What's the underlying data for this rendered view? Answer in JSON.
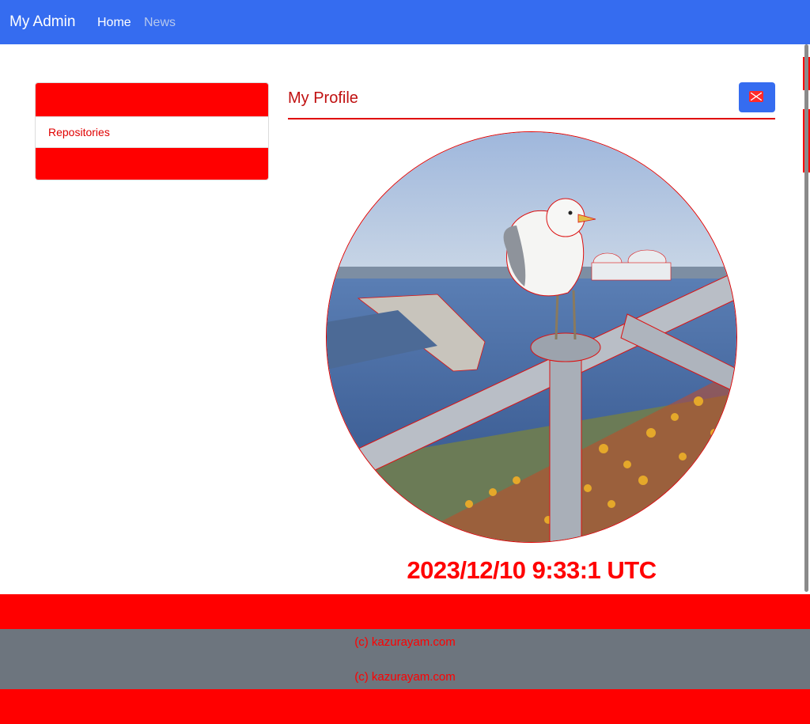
{
  "navbar": {
    "brand": "My Admin",
    "links": [
      {
        "label": "Home",
        "active": true
      },
      {
        "label": "News",
        "active": false
      }
    ],
    "color": "#356cf0"
  },
  "sidebar": {
    "items": [
      {
        "label": "",
        "highlighted": true
      },
      {
        "label": "Repositories",
        "highlighted": false
      },
      {
        "label": "",
        "highlighted": true
      }
    ]
  },
  "profile": {
    "title": "My Profile",
    "mail_icon": "envelope-icon",
    "photo_subject": "seagull-perched-on-railing-icon",
    "timestamp": "2023/12/10 9:33:1 UTC"
  },
  "footer": {
    "copyright_top": "(c) kazurayam.com",
    "copyright_bottom": "(c) kazurayam.com"
  },
  "colors": {
    "accent": "#356cf0",
    "highlight": "#ff0000",
    "footer": "#6d757e"
  }
}
